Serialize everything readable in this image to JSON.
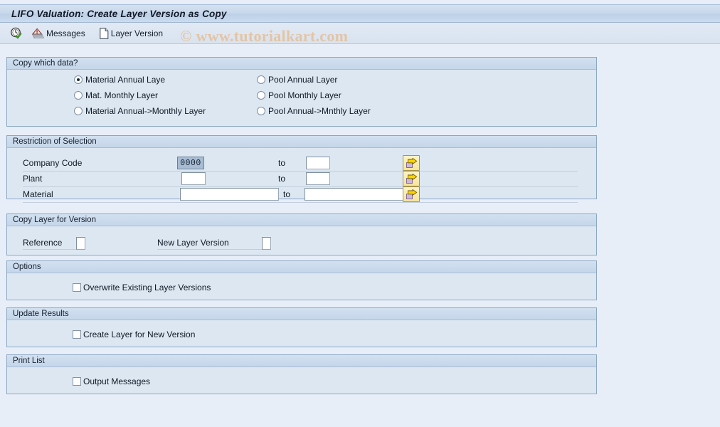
{
  "window": {
    "title": "LIFO Valuation: Create Layer Version as Copy"
  },
  "toolbar": {
    "execute_icon": "execute-clock-check-icon",
    "messages_label": "Messages",
    "messages_icon": "messages-warning-icon",
    "layer_version_label": "Layer Version",
    "layer_version_icon": "document-icon"
  },
  "watermark": {
    "text": "© www.tutorialkart.com",
    "color": "#e8b277"
  },
  "copy_which_data": {
    "title": "Copy which data?",
    "left_options": [
      {
        "label": "Material Annual Laye",
        "selected": true
      },
      {
        "label": "Mat. Monthly Layer",
        "selected": false
      },
      {
        "label": "Material Annual->Monthly Layer",
        "selected": false
      }
    ],
    "right_options": [
      {
        "label": "Pool Annual Layer",
        "selected": false
      },
      {
        "label": "Pool Monthly Layer",
        "selected": false
      },
      {
        "label": "Pool Annual->Mnthly Layer",
        "selected": false
      }
    ]
  },
  "restriction_of_selection": {
    "title": "Restriction of Selection",
    "to_label": "to",
    "multi_select_icon": "multiple-selection-arrow-icon",
    "rows": [
      {
        "label": "Company Code",
        "from_value": "0000",
        "from_selected": true,
        "to_value": ""
      },
      {
        "label": "Plant",
        "from_value": "",
        "from_selected": false,
        "to_value": ""
      },
      {
        "label": "Material",
        "from_value": "",
        "from_selected": false,
        "to_value": ""
      }
    ]
  },
  "copy_layer_for_version": {
    "title": "Copy Layer for Version",
    "reference_label": "Reference",
    "reference_value": "",
    "new_layer_version_label": "New Layer Version",
    "new_layer_version_value": ""
  },
  "options": {
    "title": "Options",
    "checkbox_label": "Overwrite Existing Layer Versions",
    "checked": false
  },
  "update_results": {
    "title": "Update Results",
    "checkbox_label": "Create Layer for New Version",
    "checked": false
  },
  "print_list": {
    "title": "Print List",
    "checkbox_label": "Output Messages",
    "checked": false
  }
}
